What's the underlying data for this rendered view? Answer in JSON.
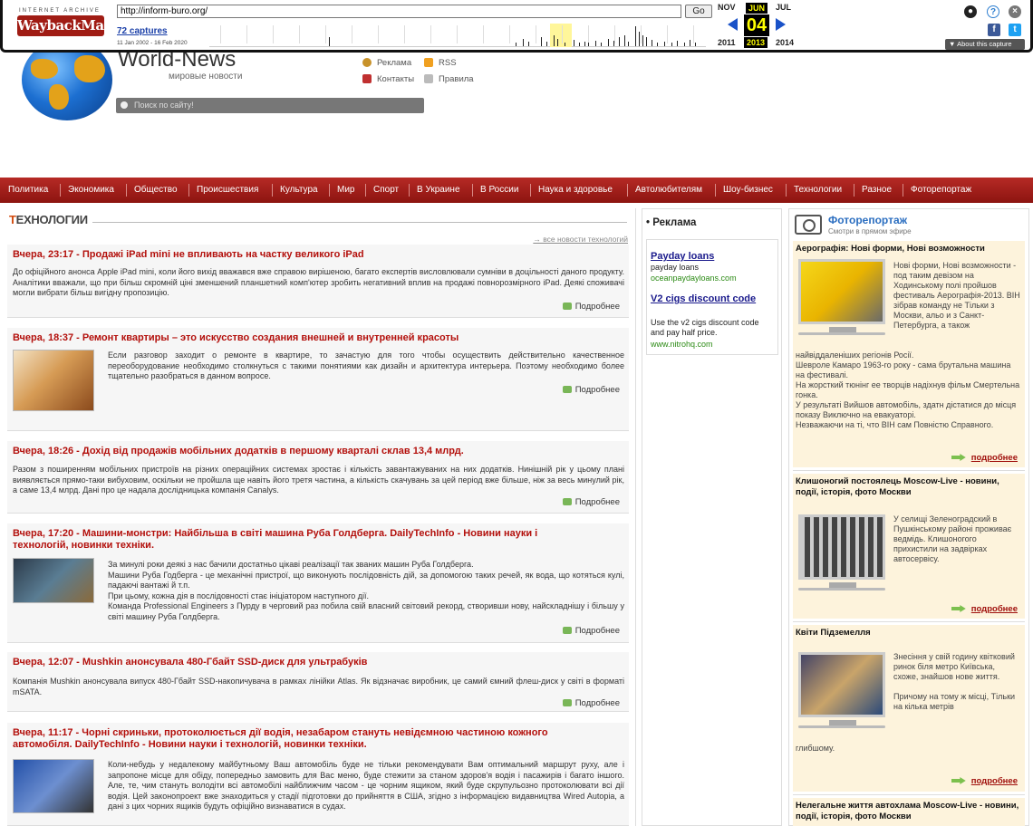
{
  "wayback": {
    "logo_top": "INTERNET ARCHIVE",
    "logo": "WaybackMachine",
    "url": "http://inform-buro.org/",
    "go": "Go",
    "captures": "72 captures",
    "range": "11 Jan 2002 - 16 Feb 2020",
    "months": [
      "NOV",
      "JUN",
      "JUL"
    ],
    "day": "04",
    "years": [
      "2011",
      "2013",
      "2014"
    ],
    "about": "▼ About this capture",
    "icons": [
      "user-icon",
      "help-icon",
      "close-icon",
      "facebook-icon",
      "twitter-icon"
    ]
  },
  "site": {
    "title": "World-News",
    "subtitle": "мировые новости",
    "links": [
      "Реклама",
      "RSS",
      "Контакты",
      "Правила"
    ],
    "search_placeholder": "Поиск по сайту!"
  },
  "nav": [
    "Политика",
    "Экономика",
    "Общество",
    "Происшествия",
    "Культура",
    "Мир",
    "Спорт",
    "В Украине",
    "В России",
    "Наука и здоровье",
    "Автолюбителям",
    "Шоу-бизнес",
    "Технологии",
    "Разное",
    "Фоторепортаж"
  ],
  "main": {
    "heading_first": "Т",
    "heading_rest": "ЕХНОЛОГИИ",
    "all_link": "→ все новости технологий",
    "more": "Подробнее",
    "articles": [
      {
        "title": "Вчера, 23:17 - Продажі iPad mini не впливають на частку великого iPad",
        "body": "До офіційного анонса Apple iPad mini, коли його вихід вважався вже справою вирішеною, багато експертів висловлювали сумніви в доцільності даного продукту. Аналітики вважали, що при більш скромній ціні зменшений планшетний комп'ютер зробить негативний вплив на продажі повнорозмірного iPad. Деякі споживачі могли вибрати більш вигідну пропозицію."
      },
      {
        "title": "Вчера, 18:37 - Ремонт квартиры – это искусство создания внешней и внутренней красоты",
        "body": "Если разговор заходит о ремонте в квартире, то зачастую для того чтобы осуществить действительно качественное переоборудование необходимо столкнуться с такими понятиями как дизайн и архитектура интерьера. Поэтому необходимо более тщательно разобраться в данном вопросе."
      },
      {
        "title": "Вчера, 18:26 - Дохід від продажів мобільних додатків в першому кварталі склав 13,4 млрд.",
        "body": "Разом з поширенням мобільних пристроїв на різних операційних системах зростає і кількість завантажуваних на них додатків. Нинішній рік у цьому плані виявляється прямо-таки вибуховим, оскільки не пройшла ще навіть його третя частина, а кількість скачувань за цей період вже більше, ніж за весь минулий рік, а саме 13,4 млрд. Дані про це надала дослідницька компанія Canalys."
      },
      {
        "title": "Вчера, 17:20 - Машини-монстри: Найбільша в світі машина Руба Голдберга. DailyTechInfo - Новини науки і технологій, новинки техніки.",
        "body": "За минулі роки деякі з нас бачили достатньо цікаві реалізації так званих машин Руба Голдберга.\nМашини Руба Годберга - це механічні пристрої, що виконують послідовність дій, за допомогою таких речей, як вода, що котяться кулі, падаючі вантажі й т.п.\nПри цьому, кожна дія в послідовності стає ініціатором наступного дії.\nКоманда Professional Engineers з Пурду в черговий раз побила свій власний світовий рекорд, створивши нову, найскладнішу і більшу у світі машину Руба Голдберга."
      },
      {
        "title": "Вчера, 12:07 - Mushkin анонсувала 480-Гбайт SSD-диск для ультрабуків",
        "body": "Компанія Mushkin анонсувала випуск 480-Гбайт SSD-накопичувача в рамках лінійки Atlas. Як відзначає виробник, це самий ємний флеш-диск у світі в форматі mSATA."
      },
      {
        "title": "Вчера, 11:17 - Чорні скриньки, протоколюється дії водія, незабаром стануть невідємною частиною кожного автомобіля. DailyTechInfo - Новини науки і технологій, новинки техніки.",
        "body": "Коли-небудь у недалекому майбутньому Ваш автомобіль буде не тільки рекомендувати Вам оптимальний маршрут руху, але і запропоне місце для обіду, попередньо замовить для Вас меню, буде стежити за станом здоров'я водія і пасажирів і багато іншого. Але, те, чим стануть володіти всі автомобілі найближчим часом - це чорним ящиком, який буде скрупульозно протоколювати всі дії водія. Цей законопроект вже знаходиться у стадії підготовки до прийняття в США, згідно з інформацією видавництва Wired Autopia, а дані з цих чорних ящиків будуть офіційно визнаватися в судах."
      }
    ]
  },
  "ads": {
    "heading": "• Реклама",
    "items": [
      {
        "title": "Payday loans",
        "text": "payday loans",
        "url": "oceanpaydayloans.com"
      },
      {
        "title": "V2 cigs discount code",
        "text": "Use the v2 cigs discount code and pay half price.",
        "url": "www.nitrohq.com"
      }
    ]
  },
  "photo": {
    "heading": "Фоторепортаж",
    "sub": "Смотри в прямом эфире",
    "more": "подробнее",
    "cards": [
      {
        "title": "Аерографія: Нові форми, Нові возможности",
        "side": "Нові форми, Нові возможности - под таким девізом на Ходинському полі пройшов фестиваль Аерографія-2013. ВІН зібрав команду не Тільки з Москви, альо и з Санкт-Петербурга, а також",
        "text": "найвіддаленіших регіонів Росії.\nШевроле Камаро 1963-го року - сама брутальна машина на фестивалі.\nНа жорсткий тюнінг ее творців надіхнув фільм Смертельна гонка.\nУ результаті Вийшов автомобіль, здатн дістатися до місця показу Виключно на евакуаторі.\nНезважаючи на ті, что ВІН сам Повністю Справного."
      },
      {
        "title": "Клишоногий постоялець Moscow-Live - новини, події, історія, фото Москви",
        "side": "У селищі Зеленоградский в Пушкінському районі проживає ведмідь. Клишоногого прихистили на задвірках автосервісу.",
        "text": ""
      },
      {
        "title": "Квіти Підземелля",
        "side": "Знесіння у свій годину квітковий ринок біля метро Київська, схоже, знайшов нове життя.\n\nПричому на тому ж місці, Тільки на кілька метрів",
        "text": "глибшому."
      },
      {
        "title": "Нелегальне життя автохлама Moscow-Live - новини, події, історія, фото Москви",
        "side": "",
        "text": ""
      }
    ]
  }
}
